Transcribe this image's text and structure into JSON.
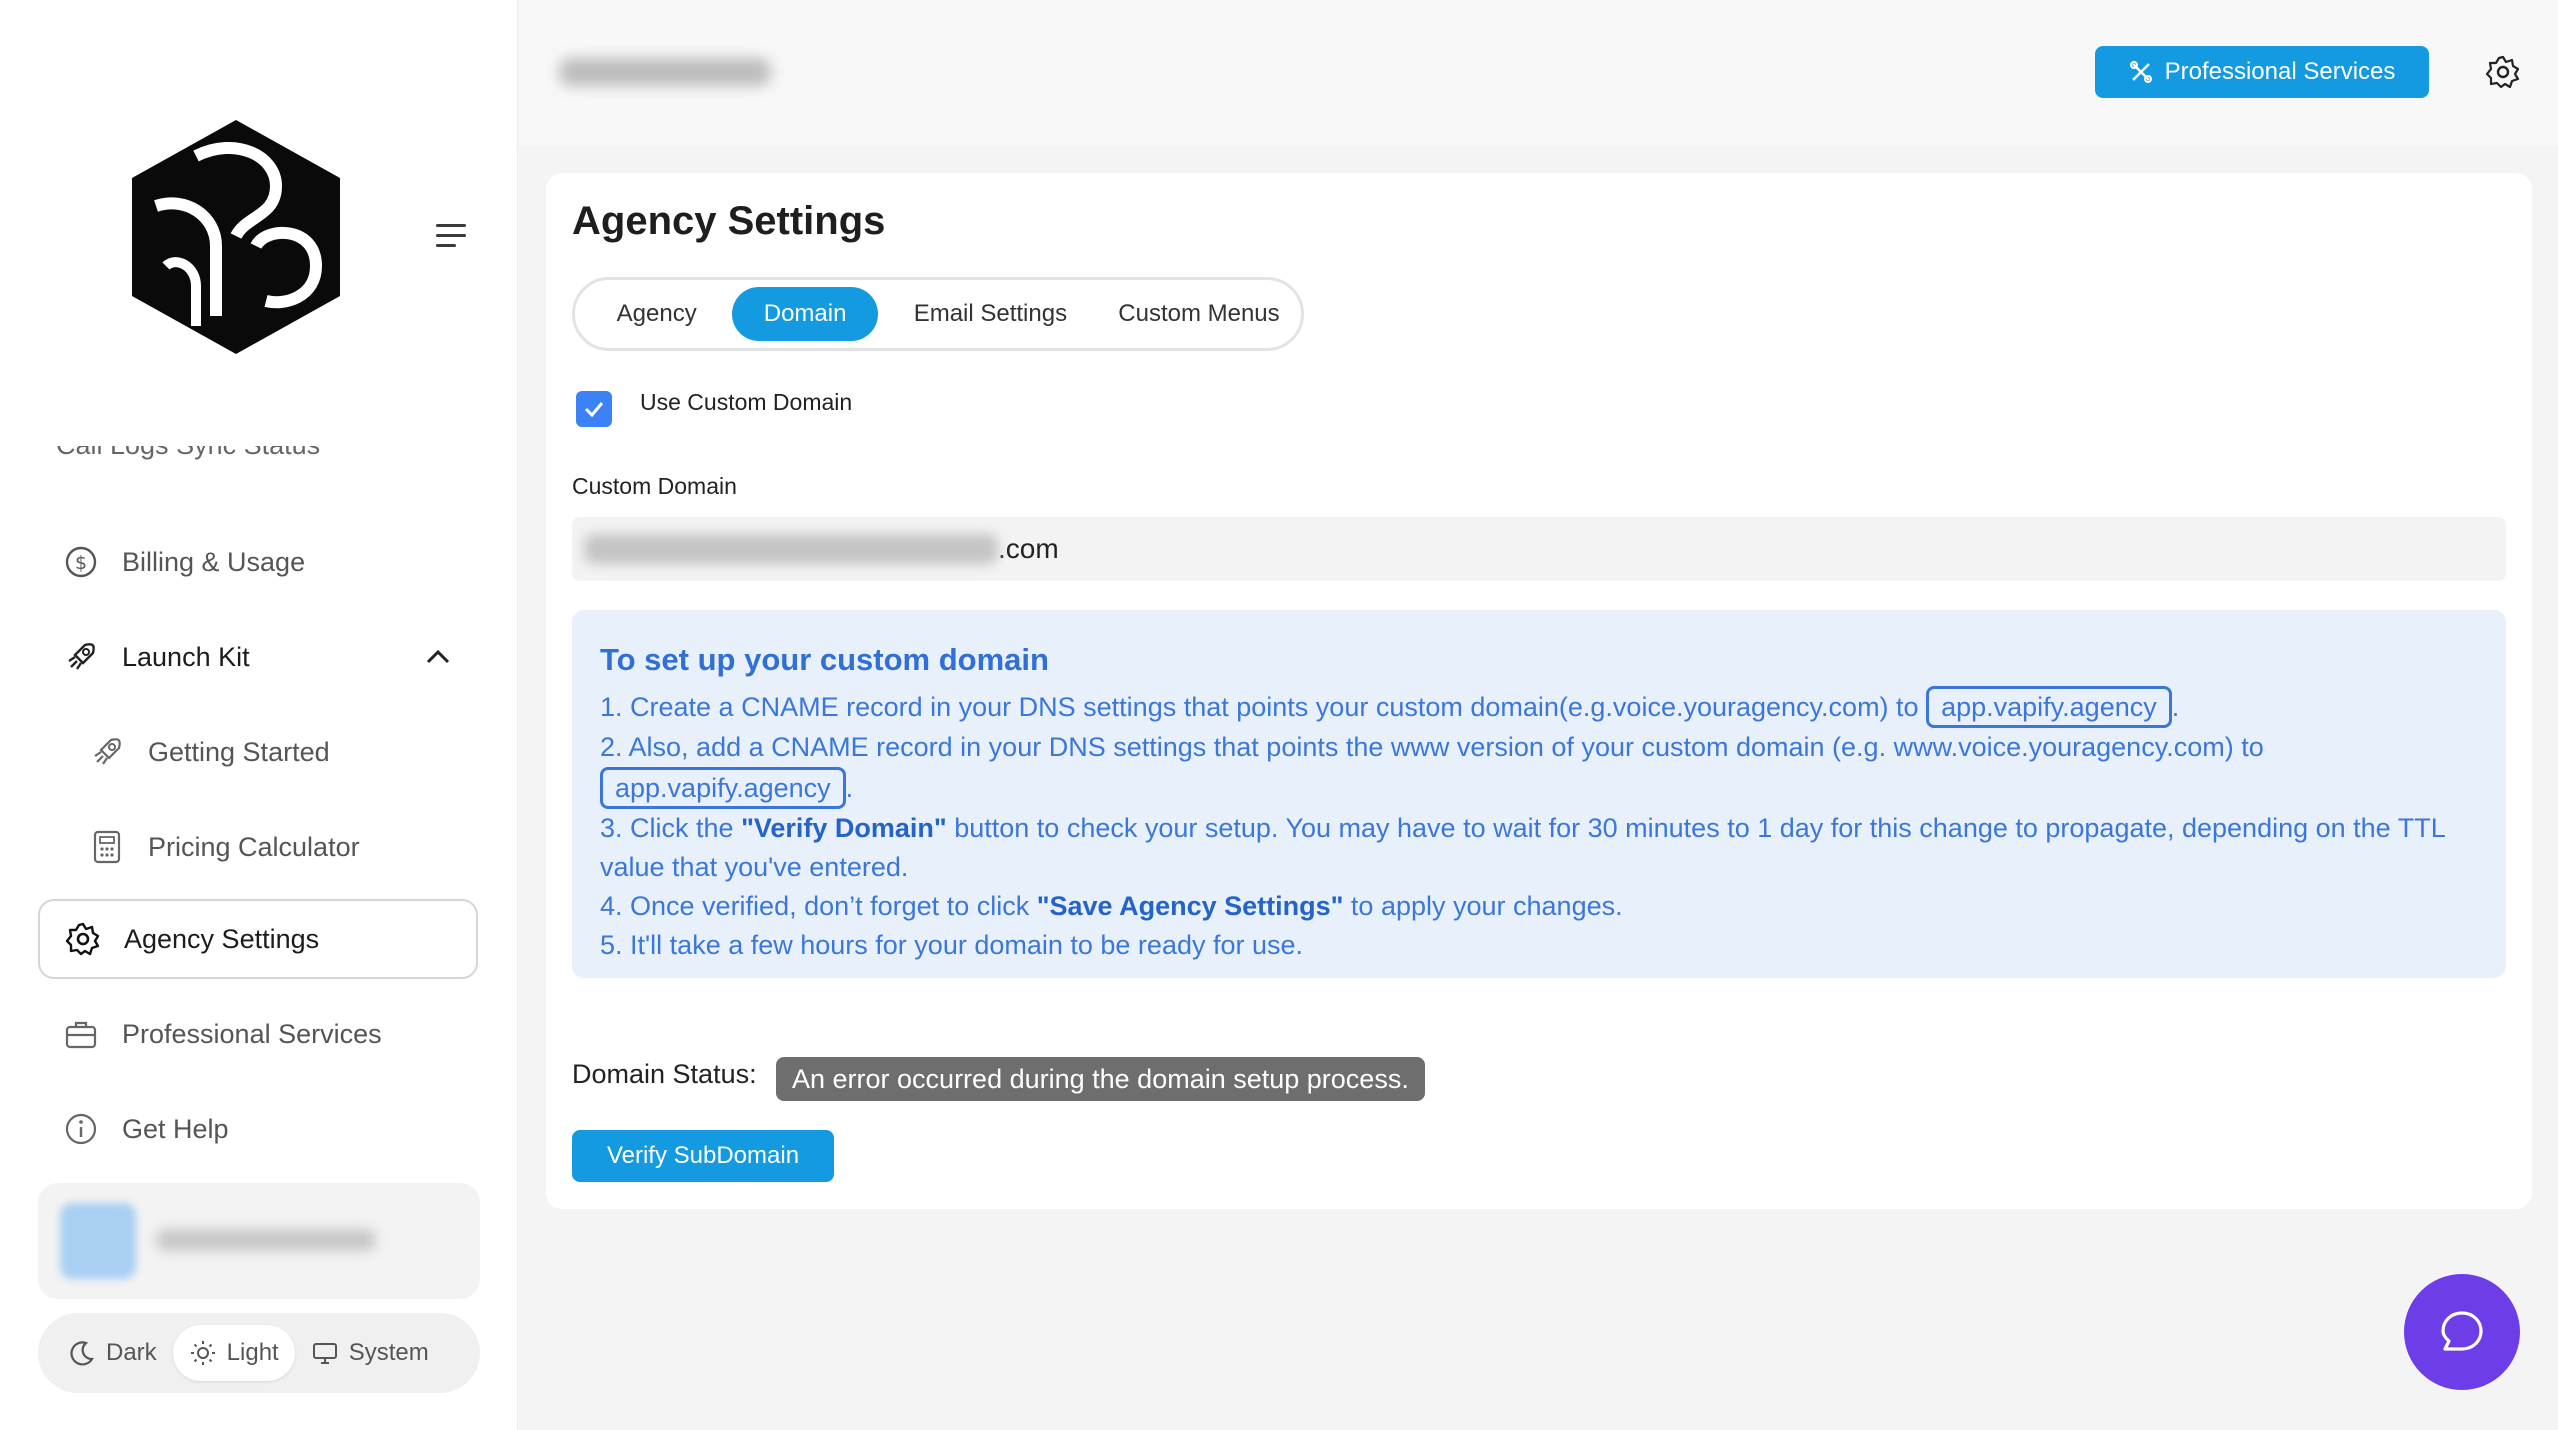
{
  "sidebar": {
    "cut_item_label": "Call Logs Sync Status",
    "items": [
      {
        "label": "Billing & Usage",
        "icon": "dollar-circle-icon"
      },
      {
        "label": "Launch Kit",
        "icon": "rocket-icon"
      },
      {
        "label": "Getting Started",
        "icon": "rocket-icon"
      },
      {
        "label": "Pricing Calculator",
        "icon": "calculator-icon"
      },
      {
        "label": "Agency Settings",
        "icon": "gear-icon"
      },
      {
        "label": "Professional Services",
        "icon": "briefcase-icon"
      },
      {
        "label": "Get Help",
        "icon": "info-circle-icon"
      }
    ],
    "theme": {
      "dark": "Dark",
      "light": "Light",
      "system": "System",
      "selected": "Light"
    }
  },
  "header": {
    "professional_services_label": "Professional Services"
  },
  "main": {
    "title": "Agency Settings",
    "tabs": [
      {
        "label": "Agency"
      },
      {
        "label": "Domain"
      },
      {
        "label": "Email Settings"
      },
      {
        "label": "Custom Menus"
      }
    ],
    "active_tab": "Domain",
    "use_custom_domain_label": "Use Custom Domain",
    "use_custom_domain_checked": true,
    "custom_domain_label": "Custom Domain",
    "custom_domain_visible_suffix": ".com",
    "info": {
      "title": "To set up your custom domain",
      "step1_text": "1. Create a CNAME record in your DNS settings that points your custom domain(e.g.voice.youragency.com) to ",
      "step1_chip": "app.vapify.agency",
      "step1_end": ".",
      "step2_text": "2. Also, add a CNAME record in your DNS settings that points the www version of your custom domain (e.g. www.voice.youragency.com) to",
      "step2_chip": "app.vapify.agency",
      "step2_end": ".",
      "step3_a": "3. Click the ",
      "step3_b": "\"Verify Domain\"",
      "step3_c": " button to check your setup. You may have to wait for 30 minutes to 1 day for this change to propagate, depending on the TTL value that you've entered.",
      "step4_a": "4. Once verified, don’t forget to click ",
      "step4_b": "\"Save Agency Settings\"",
      "step4_c": " to apply your changes.",
      "step5": "5. It'll take a few hours for your domain to be ready for use."
    },
    "domain_status_label": "Domain Status:",
    "domain_status_value": "An error occurred during the domain setup process.",
    "verify_button_label": "Verify SubDomain"
  },
  "colors": {
    "accent": "#139ae0",
    "info_text": "#3b77db",
    "info_bg": "#e8f0fb",
    "checkbox": "#3b82f6",
    "status_badge": "#6e6e6e",
    "chat_fab": "#6d3ee8"
  }
}
